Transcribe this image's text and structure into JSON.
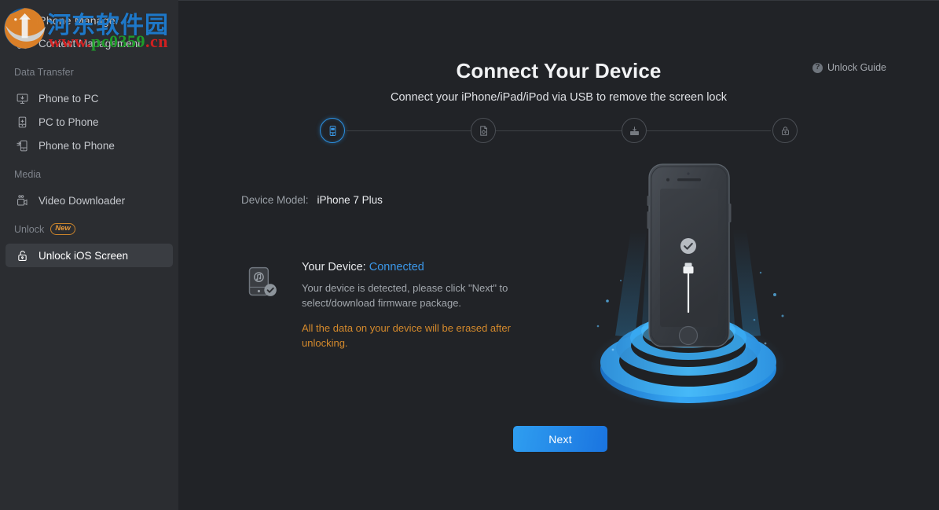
{
  "app": {
    "title": "iPhone Manager"
  },
  "watermark": {
    "chinese": "河东软件园",
    "url_red": "www.",
    "url_green": "pc0359",
    "url_red2": ".cn"
  },
  "sidebar": {
    "top_items": [
      {
        "label": "Content Management",
        "icon": "grid-icon"
      }
    ],
    "sections": [
      {
        "header": "Data Transfer",
        "badge": null,
        "items": [
          {
            "label": "Phone to PC",
            "icon": "phone-to-pc-icon"
          },
          {
            "label": "PC to Phone",
            "icon": "pc-to-phone-icon"
          },
          {
            "label": "Phone to Phone",
            "icon": "phone-to-phone-icon"
          }
        ]
      },
      {
        "header": "Media",
        "badge": null,
        "items": [
          {
            "label": "Video Downloader",
            "icon": "video-downloader-icon"
          }
        ]
      },
      {
        "header": "Unlock",
        "badge": "New",
        "items": [
          {
            "label": "Unlock iOS Screen",
            "icon": "unlock-padlock-icon",
            "active": true
          }
        ]
      }
    ]
  },
  "main": {
    "unlock_guide": {
      "label": "Unlock Guide",
      "icon": "question-mark-icon"
    },
    "title": "Connect Your Device",
    "subtitle": "Connect your iPhone/iPad/iPod via USB to remove the screen lock",
    "steps": [
      {
        "name": "connect-device",
        "icon": "dfu-phone-icon",
        "state": "active"
      },
      {
        "name": "select-firmware",
        "icon": "firmware-file-icon",
        "state": "pending"
      },
      {
        "name": "download-firmware",
        "icon": "download-tray-icon",
        "state": "pending"
      },
      {
        "name": "unlock",
        "icon": "padlock-icon",
        "state": "pending"
      }
    ],
    "device_model": {
      "key": "Device Model:",
      "value": "iPhone 7 Plus"
    },
    "connection": {
      "icon": "device-connected-icon",
      "label": "Your Device:",
      "status": "Connected",
      "status_color": "#3b97e8",
      "description": "Your device is detected, please click \"Next\" to select/download firmware package.",
      "warning": "All the data on your device will be erased after unlocking.",
      "warning_color": "#d58a2c"
    },
    "next_button": {
      "label": "Next"
    },
    "illustration": {
      "name": "connected-iphone-illustration",
      "screen_icons": [
        "check-circle-icon",
        "usb-cable-icon"
      ],
      "glow_color": "#2196f3"
    }
  },
  "colors": {
    "sidebar_bg": "#2b2d31",
    "main_bg": "#212327",
    "accent": "#2b8fe0",
    "warning": "#d58a2c",
    "badge": "#e0963a"
  }
}
